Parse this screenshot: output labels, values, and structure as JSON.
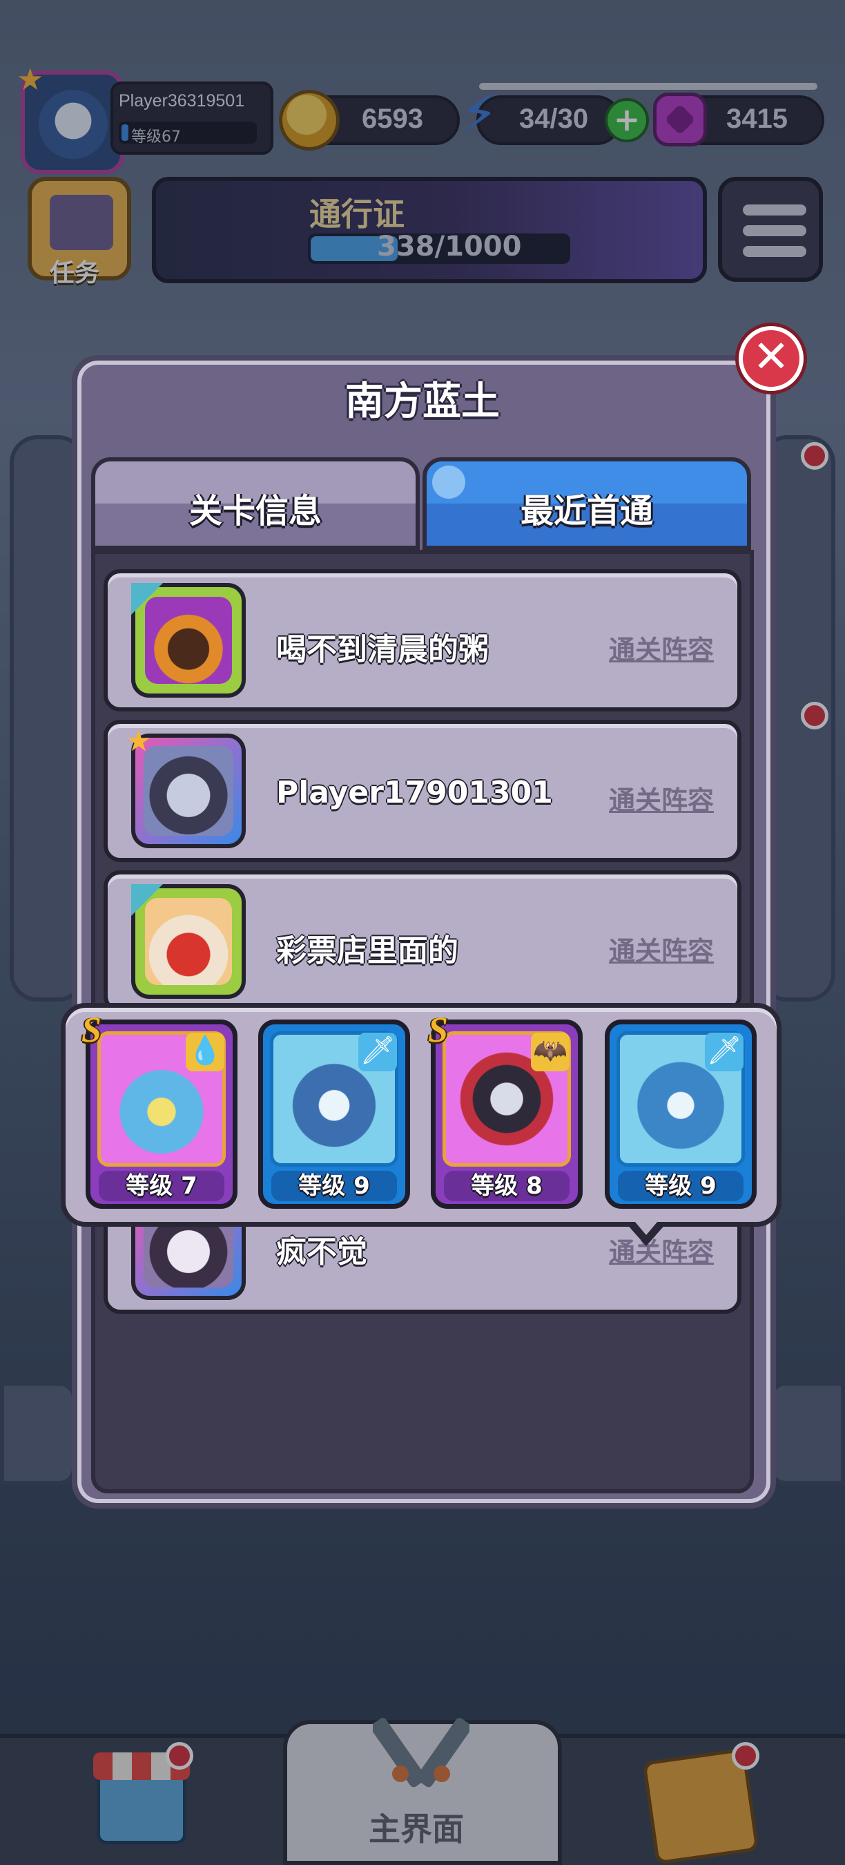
{
  "hud": {
    "player_name": "Player36319501",
    "player_level": "等级67",
    "gold": "6593",
    "energy": "34/30",
    "gems": "3415",
    "task_label": "任务",
    "pass_title": "通行证",
    "pass_progress": "338/1000",
    "pass_progress_fraction": 0.338
  },
  "modal": {
    "title": "南方蓝土",
    "tabs": [
      {
        "label": "关卡信息",
        "active": false
      },
      {
        "label": "最近首通",
        "active": true
      }
    ],
    "rows": [
      {
        "name": "喝不到清晨的粥",
        "link": "通关阵容",
        "avatar": "hooded-icon"
      },
      {
        "name": "Player17901301",
        "link": "通关阵容",
        "avatar": "vampire-icon"
      },
      {
        "name": "彩票店里面的",
        "link": "通关阵容",
        "avatar": "red-warrior-icon"
      },
      {
        "name": "疯不觉",
        "link": "通关阵容",
        "avatar": "horned-icon"
      }
    ]
  },
  "lineup": {
    "cards": [
      {
        "level": "等级 7",
        "rarity": "S",
        "color": "purple",
        "element": "water-drop-icon"
      },
      {
        "level": "等级 9",
        "rarity": "",
        "color": "blue",
        "element": "sword-icon"
      },
      {
        "level": "等级 8",
        "rarity": "S",
        "color": "purple",
        "element": "bat-icon"
      },
      {
        "level": "等级 9",
        "rarity": "",
        "color": "blue",
        "element": "sword-icon"
      }
    ]
  },
  "nav": {
    "center_label": "主界面"
  },
  "colors": {
    "tab_active": "#3f8de6",
    "tab_inactive": "#8a80a4",
    "close": "#d9374a",
    "card_purple": "#8a3ebc",
    "card_blue": "#1a7fd6"
  }
}
